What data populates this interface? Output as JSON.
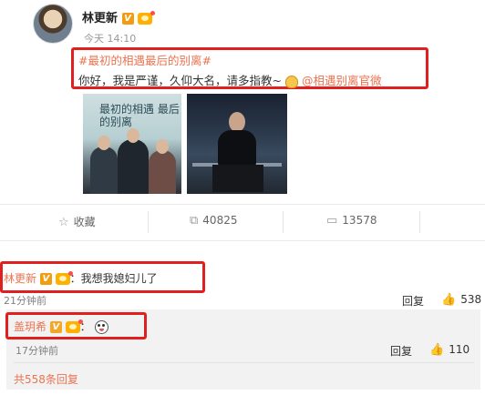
{
  "post": {
    "author": "林更新",
    "time": "今天 14:10",
    "hashtag": "#最初的相遇最后的别离#",
    "text": "你好，我是严谨，久仰大名，请多指教~",
    "mention": "@相遇别离官微",
    "poster_title": "最初的相遇 最后的别离"
  },
  "actions": {
    "favorite": "收藏",
    "repost_count": "40825",
    "comment_count": "13578"
  },
  "comments": [
    {
      "author": "林更新",
      "text": "：我想我媳妇儿了",
      "time": "21分钟前",
      "reply": "回复",
      "likes": "538"
    }
  ],
  "sub_comment": {
    "author": "盖玥希",
    "text": "：",
    "time": "17分钟前",
    "reply": "回复",
    "likes": "110"
  },
  "more_replies": "共558条回复",
  "icons": [
    "star-icon",
    "repost-icon",
    "comment-icon",
    "thumb-up-icon",
    "verified-v-icon",
    "vip-crown-icon"
  ],
  "colors": {
    "link": "#eb7350",
    "highlight_box": "#e0201f",
    "verified": "#f39c12"
  }
}
